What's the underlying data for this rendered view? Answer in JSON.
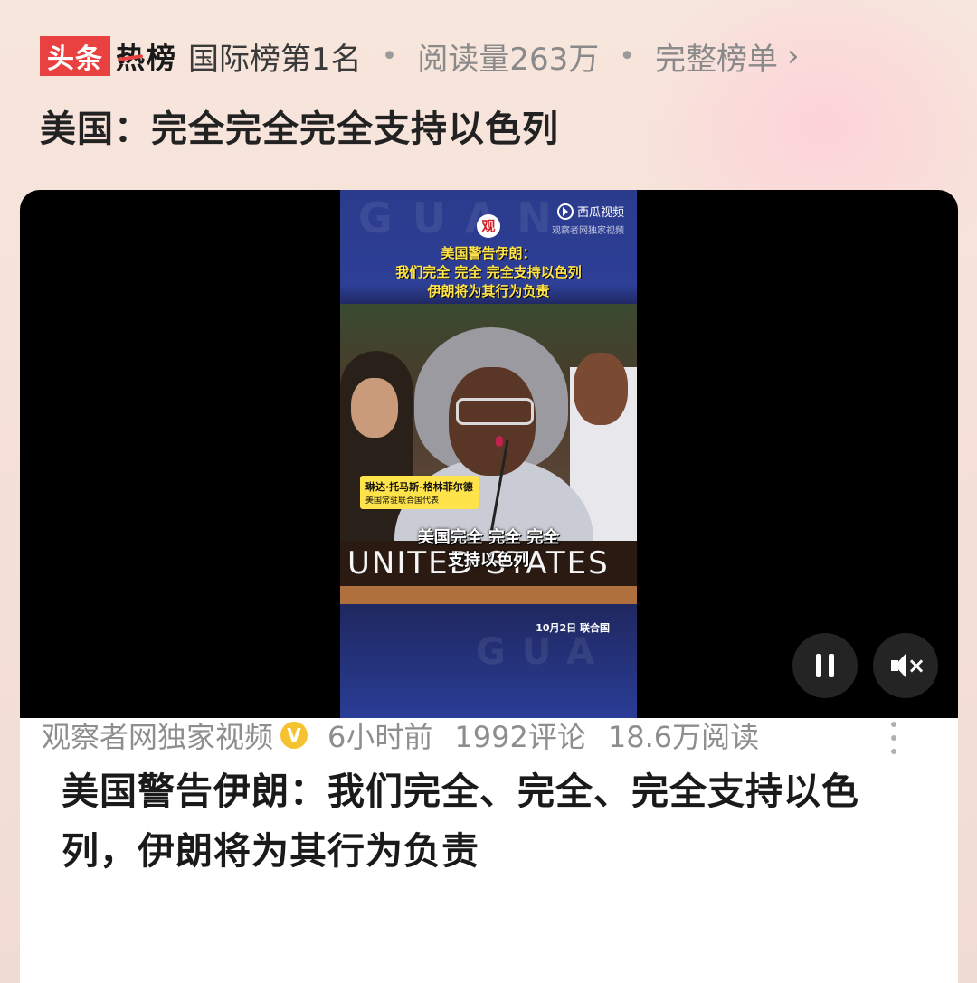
{
  "header": {
    "logo_part1": "头条",
    "logo_part2": "热榜",
    "rank": "国际榜第1名",
    "separator": "•",
    "reads": "阅读量263万",
    "full_list": "完整榜单",
    "chevron": "›"
  },
  "topic_title": "美国：完全完全完全支持以色列",
  "video": {
    "watermark_platform": "西瓜视频",
    "watermark_source": "观察者网独家视频",
    "logo_char": "观",
    "headline_lines": [
      "美国警告伊朗：",
      "我们完全 完全 完全支持以色列",
      "伊朗将为其行为负责"
    ],
    "speaker_name": "琳达·托马斯-格林菲尔德",
    "speaker_title": "美国常驻联合国代表",
    "placard": "UNITED STATES",
    "subtitle_lines": [
      "美国完全 完全 完全",
      "支持以色列"
    ],
    "date_location": "10月2日 联合国",
    "state": "playing",
    "muted": true
  },
  "article": {
    "title": "美国警告伊朗：我们完全、完全、完全支持以色列，伊朗将为其行为负责",
    "source": "观察者网独家视频",
    "verified_mark": "V",
    "time": "6小时前",
    "comments": "1992评论",
    "reads": "18.6万阅读"
  },
  "icons": {
    "pause": "pause-icon",
    "mute": "mute-icon",
    "more": "more-vertical-icon",
    "verified": "verified-badge-icon"
  },
  "colors": {
    "brand_red": "#e8413f",
    "verified_yellow": "#f5c230",
    "caption_yellow": "#ffe34a"
  }
}
